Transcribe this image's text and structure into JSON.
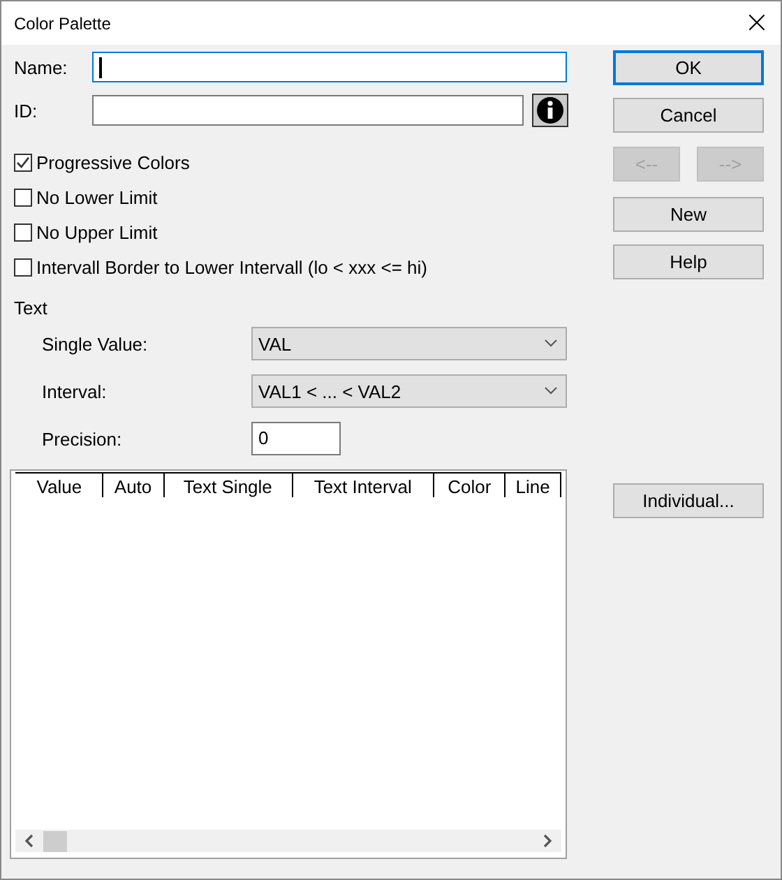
{
  "window": {
    "title": "Color Palette",
    "close": "×"
  },
  "fields": [
    {
      "label": "Name:",
      "focused": true
    },
    {
      "label": "ID:",
      "focused": false
    }
  ],
  "checkboxes": [
    {
      "label": "Progressive Colors",
      "checked": true
    },
    {
      "label": "No Lower Limit",
      "checked": false
    },
    {
      "label": "No Upper Limit",
      "checked": false
    },
    {
      "label": "Intervall Border to Lower Intervall (lo < xxx <= hi)",
      "checked": false
    }
  ],
  "text_section": {
    "title": "Text",
    "single_value": {
      "label": "Single Value:",
      "value": "VAL"
    },
    "interval": {
      "label": "Interval:",
      "value": "VAL1 < ... < VAL2"
    },
    "precision": {
      "label": "Precision:",
      "value": "0"
    }
  },
  "table": {
    "columns": [
      "Value",
      "Auto",
      "Text Single",
      "Text Interval",
      "Color",
      "Line"
    ]
  },
  "buttons": [
    {
      "label": "OK",
      "default": true,
      "disabled": false
    },
    {
      "label": "Cancel",
      "default": false,
      "disabled": false
    },
    {
      "label": "<--",
      "default": false,
      "disabled": true
    },
    {
      "label": "-->",
      "default": false,
      "disabled": true
    },
    {
      "label": "New",
      "default": false,
      "disabled": false
    },
    {
      "label": "Help",
      "default": false,
      "disabled": false
    },
    {
      "label": "Individual...",
      "default": false,
      "disabled": false
    }
  ]
}
